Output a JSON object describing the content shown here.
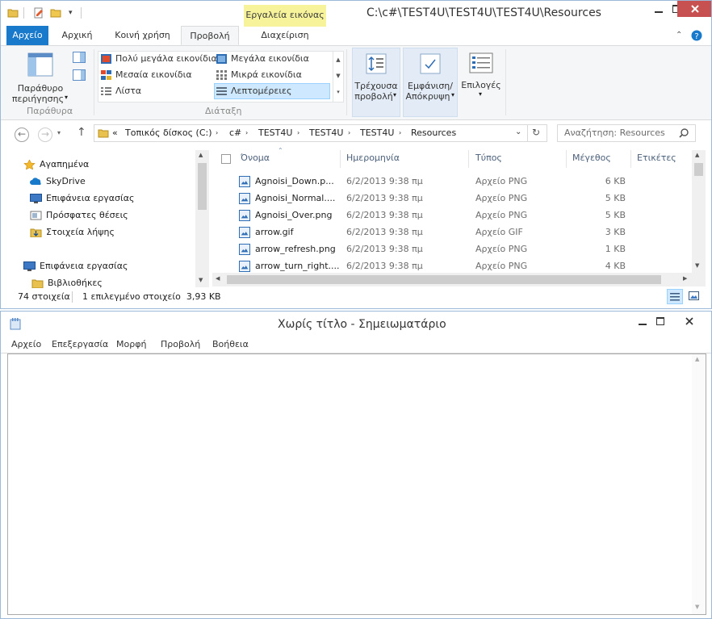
{
  "explorer": {
    "title": "C:\\c#\\TEST4U\\TEST4U\\TEST4U\\Resources",
    "context_tab": "Εργαλεία εικόνας",
    "tabs": [
      "Αρχείο",
      "Αρχική",
      "Κοινή χρήση",
      "Προβολή",
      "Διαχείριση"
    ],
    "ribbon": {
      "panes_group": {
        "nav_pane_label": "Παράθυρο",
        "nav_pane_label2": "περιήγησης",
        "group_label": "Παράθυρα"
      },
      "layout_group": {
        "items": [
          "Πολύ μεγάλα εικονίδια",
          "Μεγάλα εικονίδια",
          "Μεσαία εικονίδια",
          "Μικρά εικονίδια",
          "Λίστα",
          "Λεπτομέρειες"
        ],
        "group_label": "Διάταξη"
      },
      "current_view": {
        "label1": "Τρέχουσα",
        "label2": "προβολή"
      },
      "show_hide": {
        "label1": "Εμφάνιση/",
        "label2": "Απόκρυψη"
      },
      "options": {
        "label": "Επιλογές"
      }
    },
    "address": {
      "overflow": "«",
      "crumbs": [
        "Τοπικός δίσκος (C:)",
        "c#",
        "TEST4U",
        "TEST4U",
        "TEST4U",
        "Resources"
      ],
      "search_placeholder": "Αναζήτηση: Resources"
    },
    "nav_pane": {
      "items": [
        "Αγαπημένα",
        "SkyDrive",
        "Επιφάνεια εργασίας",
        "Πρόσφατες θέσεις",
        "Στοιχεία λήψης",
        "Επιφάνεια εργασίας",
        "Βιβλιοθήκες"
      ]
    },
    "columns": [
      "Όνομα",
      "Ημερομηνία",
      "Τύπος",
      "Μέγεθος",
      "Ετικέτες"
    ],
    "files": [
      {
        "name": "Agnoisi_Down.p...",
        "date": "6/2/2013 9:38 πμ",
        "type": "Αρχείο PNG",
        "size": "6 KB"
      },
      {
        "name": "Agnoisi_Normal....",
        "date": "6/2/2013 9:38 πμ",
        "type": "Αρχείο PNG",
        "size": "5 KB"
      },
      {
        "name": "Agnoisi_Over.png",
        "date": "6/2/2013 9:38 πμ",
        "type": "Αρχείο PNG",
        "size": "5 KB"
      },
      {
        "name": "arrow.gif",
        "date": "6/2/2013 9:38 πμ",
        "type": "Αρχείο GIF",
        "size": "3 KB"
      },
      {
        "name": "arrow_refresh.png",
        "date": "6/2/2013 9:38 πμ",
        "type": "Αρχείο PNG",
        "size": "1 KB"
      },
      {
        "name": "arrow_turn_right....",
        "date": "6/2/2013 9:38 πμ",
        "type": "Αρχείο PNG",
        "size": "4 KB"
      }
    ],
    "status": {
      "count": "74 στοιχεία",
      "selection": "1 επιλεγμένο στοιχείο  3,93 KB"
    }
  },
  "notepad": {
    "title": "Χωρίς τίτλο - Σημειωματάριο",
    "menu": [
      "Αρχείο",
      "Επεξεργασία",
      "Μορφή",
      "Προβολή",
      "Βοήθεια"
    ],
    "content": ""
  },
  "colors": {
    "accent": "#1979ca",
    "context_tab": "#f7f39a",
    "selection": "#cde8ff",
    "ribbon_bg": "#f5f6f7"
  }
}
